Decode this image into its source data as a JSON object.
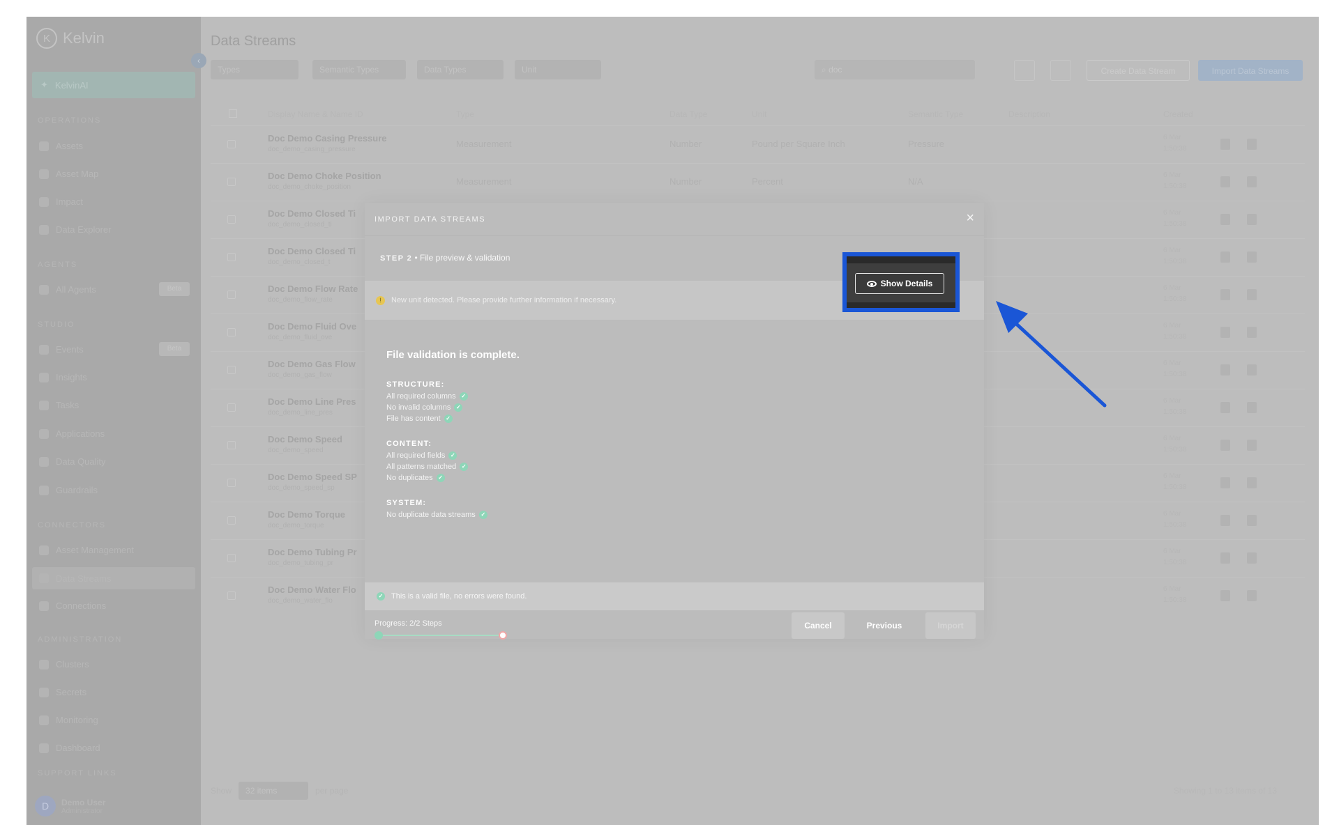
{
  "brand": {
    "name": "Kelvin",
    "logo_letter": "K"
  },
  "sidebar": {
    "selected": "KelvinAI",
    "sections": {
      "operations": "OPERATIONS",
      "agents": "AGENTS",
      "studio": "STUDIO",
      "connectors": "CONNECTORS",
      "administration": "ADMINISTRATION",
      "support": "SUPPORT LINKS"
    },
    "items": {
      "assets": "Assets",
      "asset_map": "Asset Map",
      "impact": "Impact",
      "data_explorer": "Data Explorer",
      "all_agents": "All Agents",
      "events": "Events",
      "insights": "Insights",
      "tasks": "Tasks",
      "applications": "Applications",
      "data_quality": "Data Quality",
      "guardrails": "Guardrails",
      "asset_management": "Asset Management",
      "data_streams": "Data Streams",
      "connections": "Connections",
      "clusters": "Clusters",
      "secrets": "Secrets",
      "monitoring": "Monitoring",
      "dashboard": "Dashboard"
    },
    "badges": {
      "all_agents": "Beta",
      "events": "Beta"
    },
    "user": {
      "initial": "D",
      "name": "Demo User",
      "role": "Administrator"
    }
  },
  "main": {
    "title": "Data Streams",
    "filters": [
      "Types",
      "Semantic Types",
      "Data Types",
      "Unit"
    ],
    "search_value": "doc",
    "buttons": {
      "create": "Create Data Stream",
      "import": "Import Data Streams"
    },
    "columns": [
      "Display Name & Name ID",
      "Type",
      "Data Type",
      "Unit",
      "Semantic Type",
      "Description",
      "Created"
    ],
    "rows": [
      {
        "name": "Doc Demo Casing Pressure",
        "sub": "doc_demo_casing_pressure",
        "type": "Measurement",
        "data_type": "Number",
        "unit": "Pound per Square Inch",
        "semantic": "Pressure",
        "date": "6 Mar",
        "time": "1:50:38"
      },
      {
        "name": "Doc Demo Choke Position",
        "sub": "doc_demo_choke_position",
        "type": "Measurement",
        "data_type": "Number",
        "unit": "Percent",
        "semantic": "N/A",
        "date": "6 Mar",
        "time": "1:50:38"
      },
      {
        "name": "Doc Demo Closed Ti",
        "sub": "doc_demo_closed_ti",
        "date": "6 Mar",
        "time": "1:50:38"
      },
      {
        "name": "Doc Demo Closed Ti",
        "sub": "doc_demo_closed_t",
        "date": "6 Mar",
        "time": "1:50:38"
      },
      {
        "name": "Doc Demo Flow Rate",
        "sub": "doc_demo_flow_rate",
        "date": "6 Mar",
        "time": "1:50:38"
      },
      {
        "name": "Doc Demo Fluid Ove",
        "sub": "doc_demo_fluid_ove",
        "date": "6 Mar",
        "time": "1:50:38"
      },
      {
        "name": "Doc Demo Gas Flow",
        "sub": "doc_demo_gas_flow",
        "date": "6 Mar",
        "time": "1:50:38"
      },
      {
        "name": "Doc Demo Line Pres",
        "sub": "doc_demo_line_pres",
        "date": "6 Mar",
        "time": "1:50:38"
      },
      {
        "name": "Doc Demo Speed",
        "sub": "doc_demo_speed",
        "date": "6 Mar",
        "time": "1:50:38"
      },
      {
        "name": "Doc Demo Speed SP",
        "sub": "doc_demo_speed_sp",
        "date": "6 Mar",
        "time": "1:50:38"
      },
      {
        "name": "Doc Demo Torque",
        "sub": "doc_demo_torque",
        "date": "6 Mar",
        "time": "1:50:38"
      },
      {
        "name": "Doc Demo Tubing Pr",
        "sub": "doc_demo_tubing_pr",
        "date": "6 Mar",
        "time": "1:50:38"
      },
      {
        "name": "Doc Demo Water Flo",
        "sub": "doc_demo_water_flo",
        "date": "6 Mar",
        "time": "1:50:38"
      }
    ],
    "footer": {
      "show": "Show",
      "per_page_value": "32 items",
      "per_page": "per page",
      "info": "Showing 1 to 13 items of 13"
    }
  },
  "modal": {
    "title": "IMPORT DATA STREAMS",
    "close": "×",
    "step_label": "STEP 2",
    "step_sep": "•",
    "step_name": "File preview & validation",
    "warning": "New unit detected. Please provide further information if necessary.",
    "show_details": "Show Details",
    "validation_title": "File validation is complete.",
    "structure": {
      "heading": "STRUCTURE:",
      "items": [
        "All required columns",
        "No invalid columns",
        "File has content"
      ]
    },
    "content": {
      "heading": "CONTENT:",
      "items": [
        "All required fields",
        "All patterns matched",
        "No duplicates"
      ]
    },
    "system": {
      "heading": "SYSTEM:",
      "items": [
        "No duplicate data streams"
      ]
    },
    "valid_message": "This is a valid file, no errors were found.",
    "progress_label": "Progress: 2/2 Steps",
    "progress": {
      "current": 2,
      "total": 2
    },
    "buttons": {
      "cancel": "Cancel",
      "previous": "Previous",
      "import": "Import"
    }
  },
  "colors": {
    "highlight": "#1a56d6",
    "success": "#8ed6b8",
    "warning": "#e7c653"
  }
}
